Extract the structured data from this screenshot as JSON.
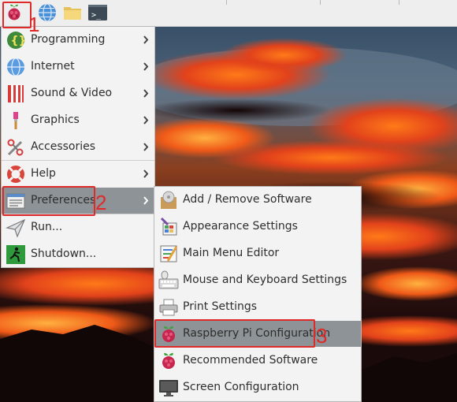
{
  "taskbar": {
    "icons": [
      "raspberry-menu-icon",
      "web-browser-icon",
      "file-manager-icon",
      "terminal-icon"
    ],
    "terminal_glyph": ">_"
  },
  "main_menu": {
    "items": [
      {
        "label": "Programming",
        "icon": "programming-icon",
        "submenu": true
      },
      {
        "label": "Internet",
        "icon": "internet-icon",
        "submenu": true
      },
      {
        "label": "Sound & Video",
        "icon": "sound-video-icon",
        "submenu": true
      },
      {
        "label": "Graphics",
        "icon": "graphics-icon",
        "submenu": true
      },
      {
        "label": "Accessories",
        "icon": "accessories-icon",
        "submenu": true
      },
      {
        "label": "Help",
        "icon": "help-icon",
        "submenu": true
      },
      {
        "label": "Preferences",
        "icon": "preferences-icon",
        "submenu": true,
        "highlighted": true
      },
      {
        "label": "Run...",
        "icon": "run-icon",
        "submenu": false
      },
      {
        "label": "Shutdown...",
        "icon": "shutdown-icon",
        "submenu": false
      }
    ]
  },
  "preferences_submenu": {
    "items": [
      {
        "label": "Add / Remove Software",
        "icon": "add-remove-software-icon"
      },
      {
        "label": "Appearance Settings",
        "icon": "appearance-settings-icon"
      },
      {
        "label": "Main Menu Editor",
        "icon": "main-menu-editor-icon"
      },
      {
        "label": "Mouse and Keyboard Settings",
        "icon": "mouse-keyboard-icon"
      },
      {
        "label": "Print Settings",
        "icon": "printer-icon"
      },
      {
        "label": "Raspberry Pi Configuration",
        "icon": "raspberry-pi-icon",
        "highlighted": true
      },
      {
        "label": "Recommended Software",
        "icon": "raspberry-pi-icon"
      },
      {
        "label": "Screen Configuration",
        "icon": "monitor-icon"
      }
    ]
  },
  "annotations": {
    "step1": "1",
    "step2": "2",
    "step3": "3"
  },
  "colors": {
    "highlight": "#8d9396",
    "annotation": "#e02a2a",
    "menu_bg": "#f3f3f3"
  }
}
